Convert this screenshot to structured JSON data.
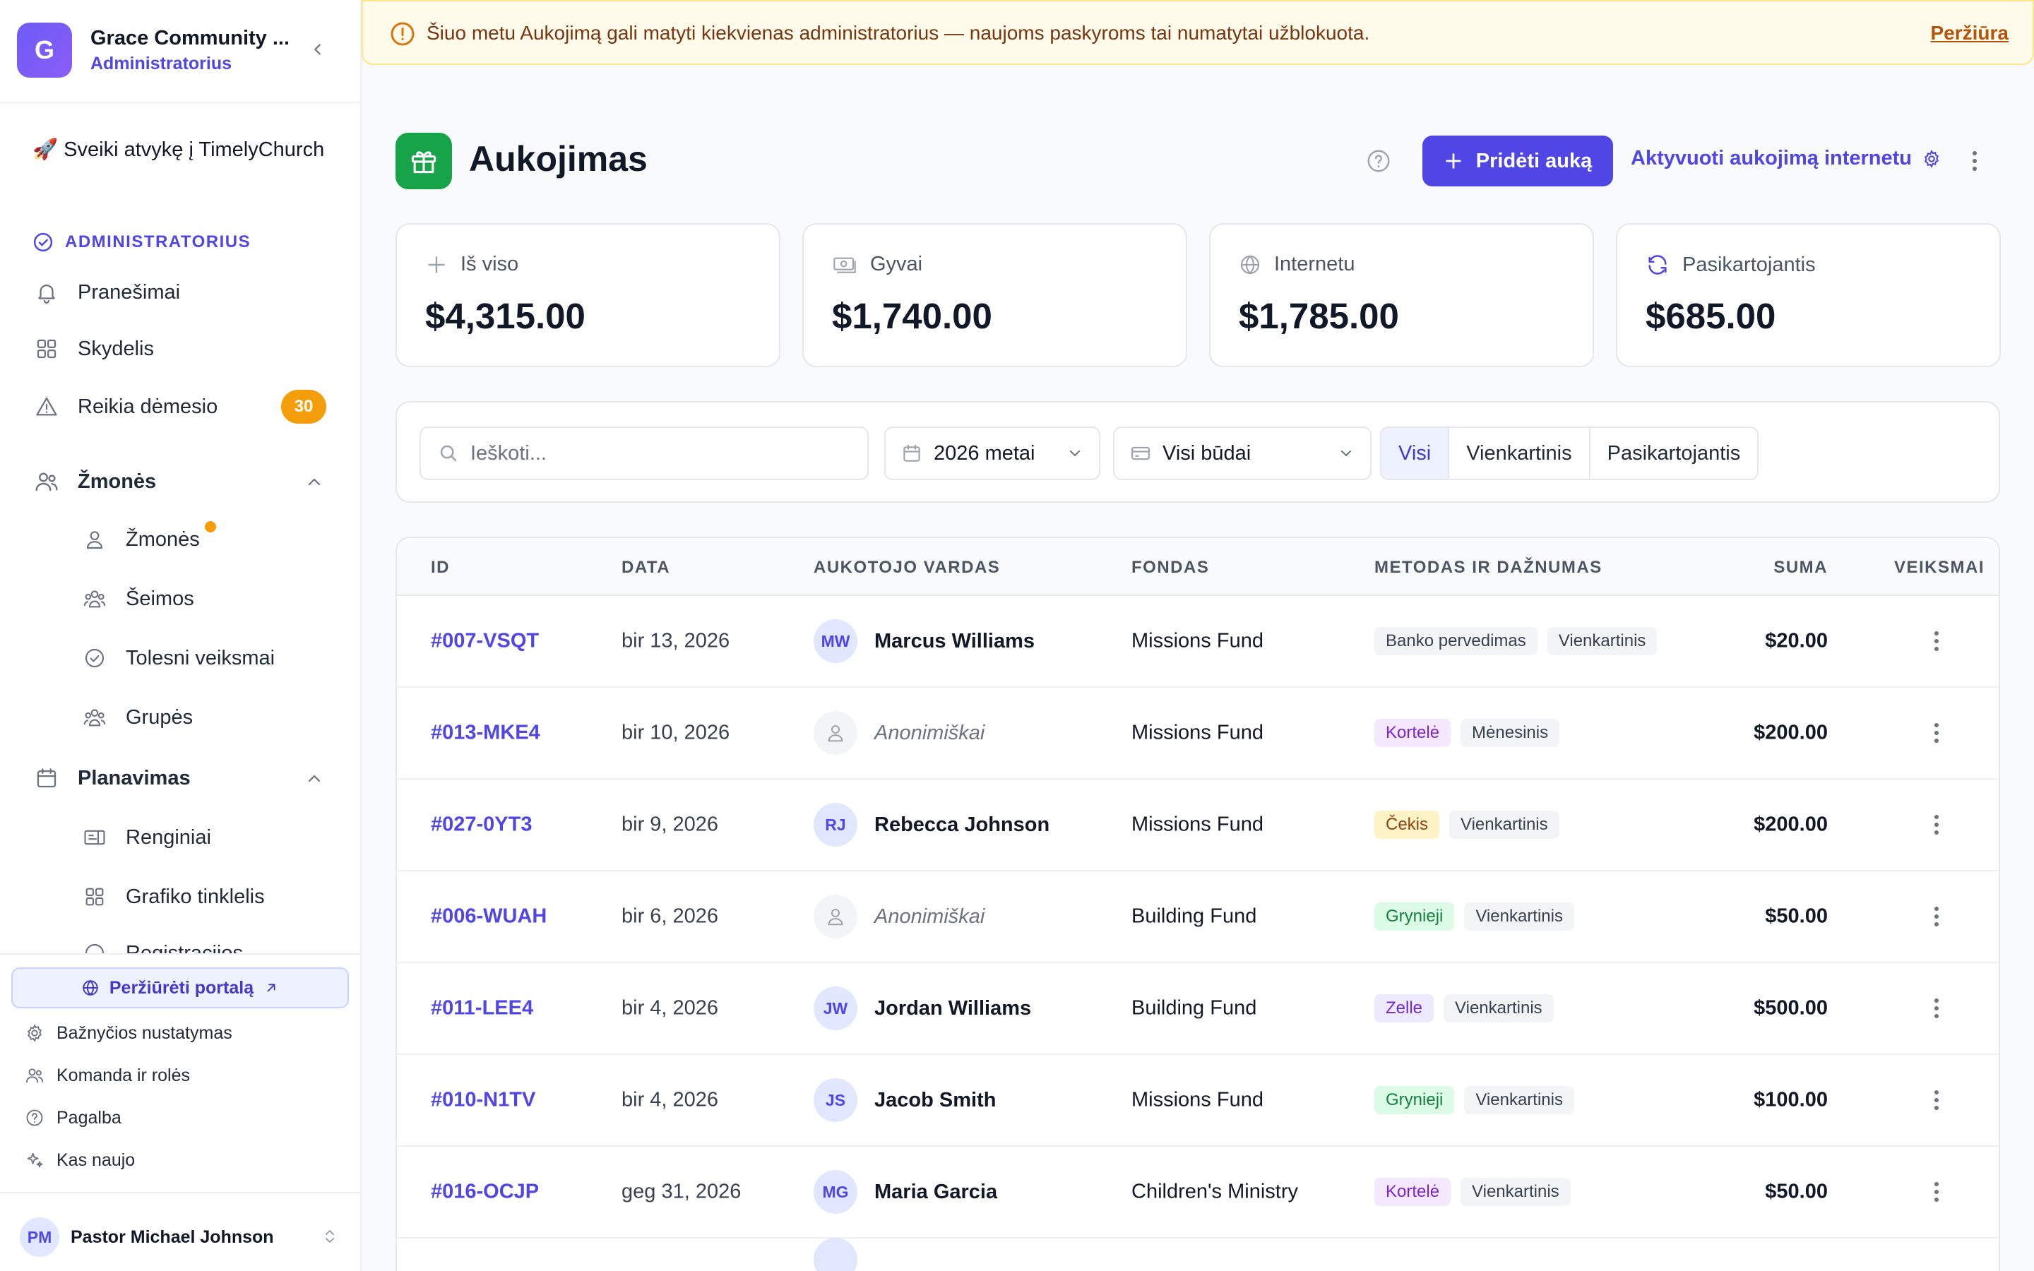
{
  "org": {
    "initial": "G",
    "name": "Grace Community ...",
    "role": "Administratorius"
  },
  "sidebar": {
    "welcome": "🚀 Sveiki atvykę į TimelyChurch",
    "section": "ADMINISTRATORIUS",
    "items": {
      "notifications": "Pranešimai",
      "dashboard": "Skydelis",
      "attention": "Reikia dėmesio",
      "attention_count": "30",
      "people_group": "Žmonės",
      "people": "Žmonės",
      "families": "Šeimos",
      "followups": "Tolesni veiksmai",
      "groups": "Grupės",
      "planning_group": "Planavimas",
      "events": "Renginiai",
      "schedule": "Grafiko tinklelis",
      "registrations": "Registracijos"
    },
    "footer": {
      "portal": "Peržiūrėti portalą",
      "church_settings": "Bažnyčios nustatymas",
      "team_roles": "Komanda ir rolės",
      "help": "Pagalba",
      "whats_new": "Kas naujo"
    },
    "user": {
      "initials": "PM",
      "name": "Pastor Michael Johnson"
    }
  },
  "alert": {
    "text": "Šiuo metu Aukojimą gali matyti kiekvienas administratorius — naujoms paskyroms tai numatytai užblokuota.",
    "link": "Peržiūra"
  },
  "page": {
    "title": "Aukojimas",
    "add_button": "Pridėti auką",
    "online_link": "Aktyvuoti aukojimą internetu"
  },
  "stats": [
    {
      "label": "Iš viso",
      "value": "$4,315.00",
      "icon": "plus-icon"
    },
    {
      "label": "Gyvai",
      "value": "$1,740.00",
      "icon": "cash-icon"
    },
    {
      "label": "Internetu",
      "value": "$1,785.00",
      "icon": "globe-icon"
    },
    {
      "label": "Pasikartojantis",
      "value": "$685.00",
      "icon": "refresh-icon"
    }
  ],
  "filters": {
    "search_placeholder": "Ieškoti...",
    "year": "2026 metai",
    "method": "Visi būdai",
    "segments": [
      "Visi",
      "Vienkartinis",
      "Pasikartojantis"
    ],
    "active_segment": "Visi"
  },
  "table": {
    "columns": [
      "ID",
      "DATA",
      "AUKOTOJO VARDAS",
      "FONDAS",
      "METODAS IR DAŽNUMAS",
      "SUMA",
      "VEIKSMAI"
    ],
    "rows": [
      {
        "id": "#007-VSQT",
        "date": "bir 13, 2026",
        "initials": "MW",
        "donor": "Marcus Williams",
        "fund": "Missions Fund",
        "method": "Banko pervedimas",
        "frequency": "Vienkartinis",
        "amount": "$20.00"
      },
      {
        "id": "#013-MKE4",
        "date": "bir 10, 2026",
        "initials": "",
        "donor": "Anonimiškai",
        "fund": "Missions Fund",
        "method": "Kortelė",
        "frequency": "Mėnesinis",
        "amount": "$200.00"
      },
      {
        "id": "#027-0YT3",
        "date": "bir 9, 2026",
        "initials": "RJ",
        "donor": "Rebecca Johnson",
        "fund": "Missions Fund",
        "method": "Čekis",
        "frequency": "Vienkartinis",
        "amount": "$200.00"
      },
      {
        "id": "#006-WUAH",
        "date": "bir 6, 2026",
        "initials": "",
        "donor": "Anonimiškai",
        "fund": "Building Fund",
        "method": "Grynieji",
        "frequency": "Vienkartinis",
        "amount": "$50.00"
      },
      {
        "id": "#011-LEE4",
        "date": "bir 4, 2026",
        "initials": "JW",
        "donor": "Jordan Williams",
        "fund": "Building Fund",
        "method": "Zelle",
        "frequency": "Vienkartinis",
        "amount": "$500.00"
      },
      {
        "id": "#010-N1TV",
        "date": "bir 4, 2026",
        "initials": "JS",
        "donor": "Jacob Smith",
        "fund": "Missions Fund",
        "method": "Grynieji",
        "frequency": "Vienkartinis",
        "amount": "$100.00"
      },
      {
        "id": "#016-OCJP",
        "date": "geg 31, 2026",
        "initials": "MG",
        "donor": "Maria Garcia",
        "fund": "Children's Ministry",
        "method": "Kortelė",
        "frequency": "Vienkartinis",
        "amount": "$50.00"
      }
    ]
  }
}
